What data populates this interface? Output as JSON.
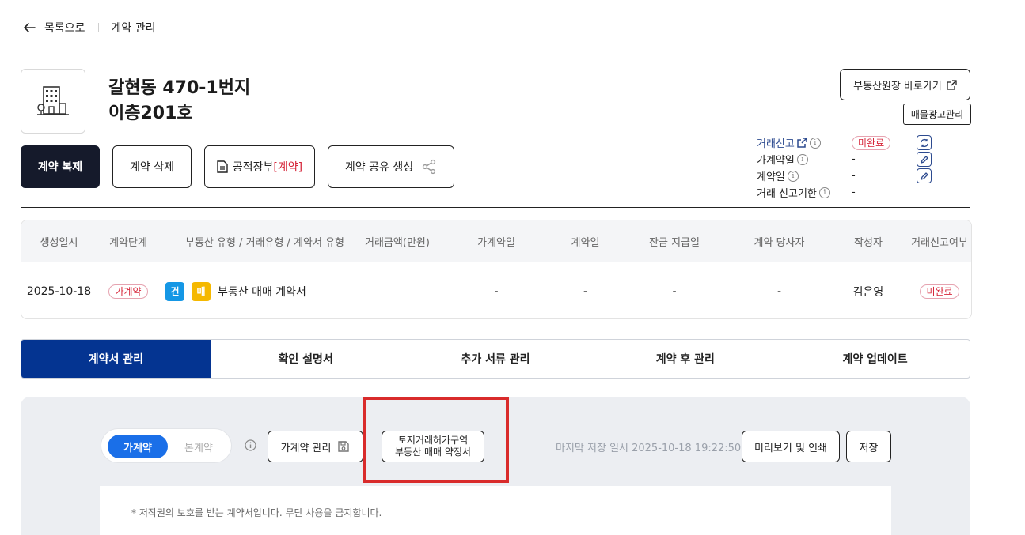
{
  "topbar": {
    "back_label": "목록으로",
    "crumb": "계약 관리"
  },
  "header": {
    "address_line1": "갈현동 470-1번지",
    "address_line2": "이층201호",
    "site_button": "부동산원장 바로가기",
    "ad_button": "매물광고관리"
  },
  "actions": {
    "duplicate": "계약 복제",
    "delete": "계약 삭제",
    "ledger_prefix": "공적장부",
    "ledger_suffix": "[계약]",
    "share": "계약 공유 생성"
  },
  "info": {
    "report_label": "거래신고",
    "report_status": "미완료",
    "provisional_label": "가계약일",
    "provisional_value": "-",
    "contract_label": "계약일",
    "contract_value": "-",
    "deadline_label": "거래 신고기한",
    "deadline_value": "-"
  },
  "table": {
    "headers": [
      "생성일시",
      "계약단계",
      "부동산 유형 / 거래유형 / 계약서 유형",
      "거래금액(만원)",
      "가계약일",
      "계약일",
      "잔금 지급일",
      "계약 당사자",
      "작성자",
      "거래신고여부"
    ],
    "row": {
      "created": "2025-10-18",
      "stage": "가계약",
      "tag1": "건",
      "tag2": "매",
      "doc_type": "부동산 매매 계약서",
      "amount": "",
      "provisional": "-",
      "contract": "-",
      "balance": "-",
      "party": "-",
      "author": "김은영",
      "report": "미완료"
    }
  },
  "tabs": [
    "계약서 관리",
    "확인 설명서",
    "추가 서류 관리",
    "계약 후 관리",
    "계약 업데이트"
  ],
  "panel": {
    "toggle_on": "가계약",
    "toggle_off": "본계약",
    "manage_button": "가계약 관리",
    "land_button_line1": "토지거래허가구역",
    "land_button_line2": "부동산 매매 약정서",
    "last_saved": "마지막 저장 일시 2025-10-18 19:22:50",
    "preview_button": "미리보기 및 인쇄",
    "save_button": "저장",
    "notice": "* 저작권의 보호를 받는 계약서입니다. 무단 사용을 금지합니다."
  },
  "colors": {
    "primary": "#043491",
    "dark": "#151a2b",
    "accent_red": "#d6263a",
    "highlight": "#d92b2b",
    "toggle_blue": "#1a6fe8"
  }
}
